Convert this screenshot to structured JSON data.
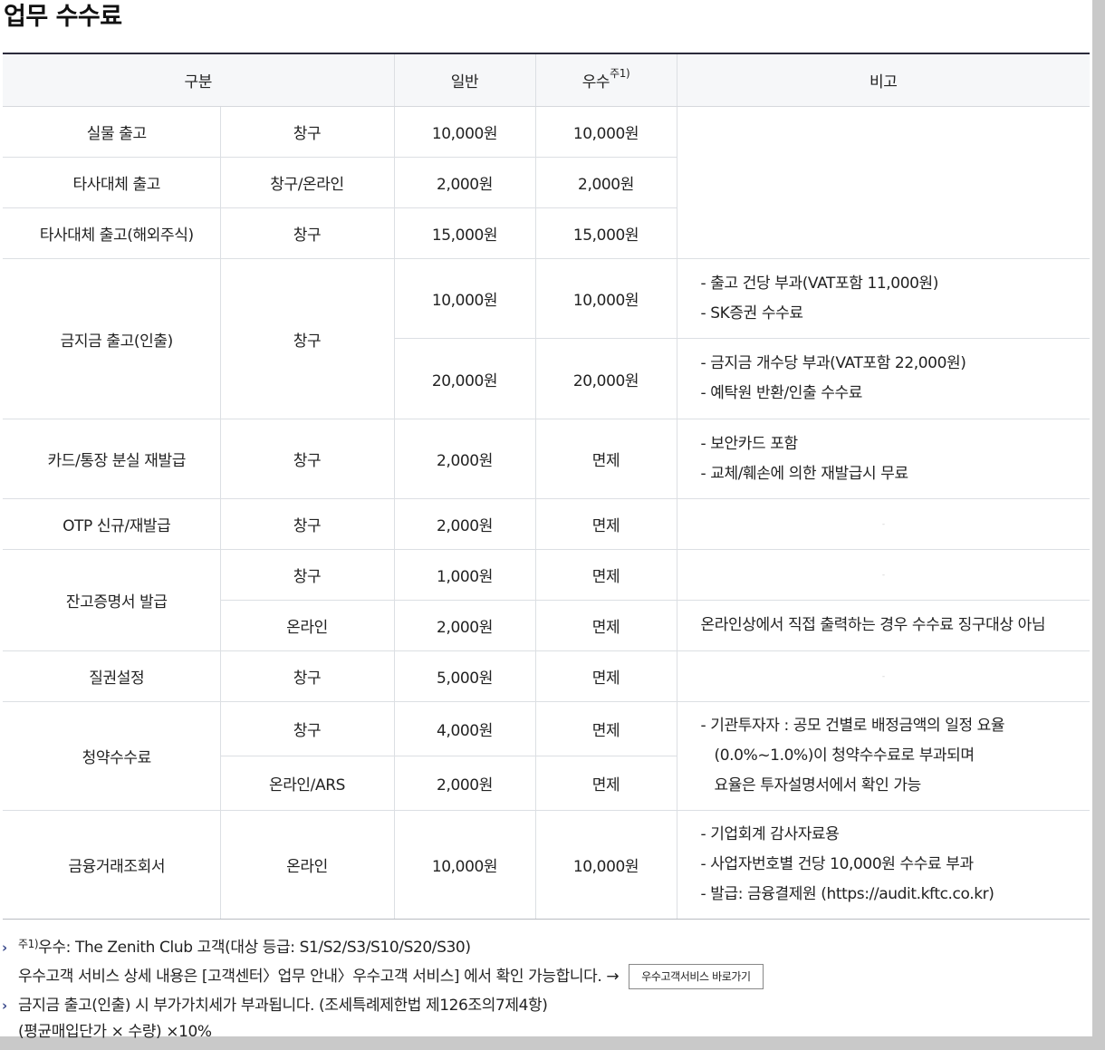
{
  "title": "업무 수수료",
  "headers": {
    "category": "구분",
    "general": "일반",
    "premium": "우수",
    "premium_sup": "주1)",
    "remarks": "비고"
  },
  "rows": {
    "r1": {
      "item": "실물 출고",
      "channel": "창구",
      "general": "10,000원",
      "premium": "10,000원"
    },
    "r2": {
      "item": "타사대체 출고",
      "channel": "창구/온라인",
      "general": "2,000원",
      "premium": "2,000원"
    },
    "r3": {
      "item": "타사대체 출고(해외주식)",
      "channel": "창구",
      "general": "15,000원",
      "premium": "15,000원"
    },
    "r4": {
      "item": "금지금 출고(인출)",
      "channel": "창구",
      "a": {
        "general": "10,000원",
        "premium": "10,000원",
        "notes": [
          "- 출고 건당 부과(VAT포함 11,000원)",
          "- SK증권 수수료"
        ]
      },
      "b": {
        "general": "20,000원",
        "premium": "20,000원",
        "notes": [
          "- 금지금 개수당 부과(VAT포함 22,000원)",
          "- 예탁원 반환/인출 수수료"
        ]
      }
    },
    "r5": {
      "item": "카드/통장 분실 재발급",
      "channel": "창구",
      "general": "2,000원",
      "premium": "면제",
      "notes": [
        "- 보안카드 포함",
        "- 교체/훼손에 의한 재발급시 무료"
      ]
    },
    "r6": {
      "item": "OTP 신규/재발급",
      "channel": "창구",
      "general": "2,000원",
      "premium": "면제",
      "note": "-"
    },
    "r7": {
      "item": "잔고증명서 발급",
      "a": {
        "channel": "창구",
        "general": "1,000원",
        "premium": "면제",
        "note": "-"
      },
      "b": {
        "channel": "온라인",
        "general": "2,000원",
        "premium": "면제",
        "note": "온라인상에서 직접 출력하는 경우 수수료 징구대상 아님"
      }
    },
    "r8": {
      "item": "질권설정",
      "channel": "창구",
      "general": "5,000원",
      "premium": "면제",
      "note": "-"
    },
    "r9": {
      "item": "청약수수료",
      "a": {
        "channel": "창구",
        "general": "4,000원",
        "premium": "면제"
      },
      "b": {
        "channel": "온라인/ARS",
        "general": "2,000원",
        "premium": "면제"
      },
      "notes": [
        "- 기관투자자 : 공모 건별로 배정금액의 일정 요율",
        "(0.0%~1.0%)이 청약수수료로 부과되며",
        "요율은 투자설명서에서 확인 가능"
      ]
    },
    "r10": {
      "item": "금융거래조회서",
      "channel": "온라인",
      "general": "10,000원",
      "premium": "10,000원",
      "notes": [
        "- 기업회계 감사자료용",
        "- 사업자번호별 건당 10,000원 수수료 부과",
        "- 발급: 금융결제원 (https://audit.kftc.co.kr)"
      ]
    }
  },
  "footnotes": {
    "fn1_sup": "주1)",
    "fn1_text": "우수: The Zenith Club 고객(대상 등급: S1/S2/S3/S10/S20/S30)",
    "fn1_line2": "우수고객 서비스 상세 내용은 [고객센터〉업무 안내〉우수고객 서비스] 에서 확인 가능합니다. →",
    "fn1_button": "우수고객서비스 바로가기",
    "fn2_line1": "금지금 출고(인출) 시 부가가치세가 부과됩니다. (조세특례제한법 제126조의7제4항)",
    "fn2_line2": "(평균매입단가 × 수량) ×10%",
    "chevron": "›"
  }
}
